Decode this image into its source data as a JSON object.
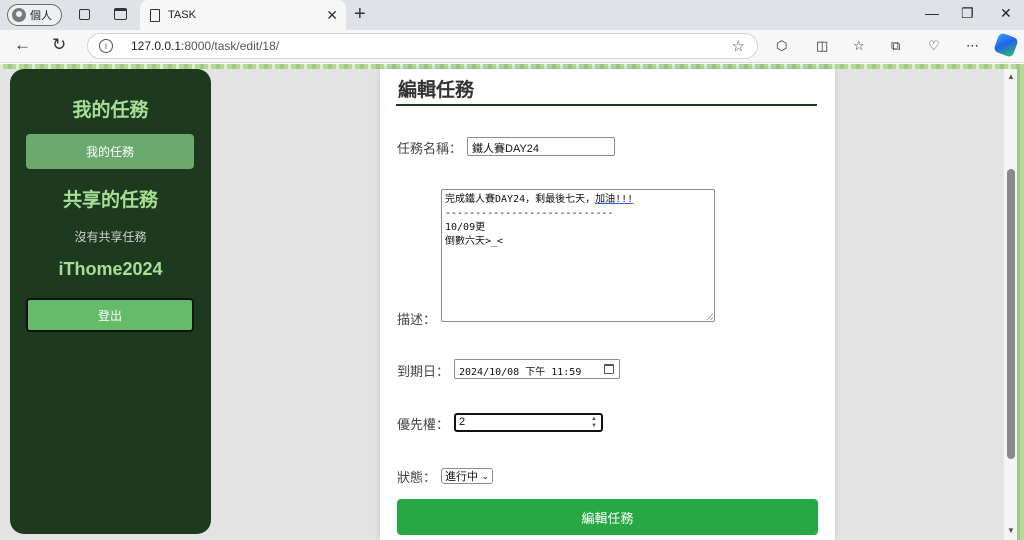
{
  "browser": {
    "profile_label": "個人",
    "tab_title": "TASK",
    "url_host": "127.0.0.1",
    "url_path": ":8000/task/edit/18/"
  },
  "sidebar": {
    "my_tasks_title": "我的任務",
    "my_tasks_button": "我的任務",
    "shared_title": "共享的任務",
    "shared_empty": "沒有共享任務",
    "username": "iThome2024",
    "logout_button": "登出"
  },
  "form": {
    "heading": "編輯任務",
    "name_label": "任務名稱：",
    "name_value": "鐵人賽DAY24",
    "desc_label": "描述：",
    "desc_line1_prefix": "完成鐵人賽DAY24，剩最後七天，",
    "desc_line1_underlined": "加油!!!",
    "desc_line2": "----------------------------",
    "desc_line3": "10/09更",
    "desc_line4": "倒數六天>_<",
    "due_label": "到期日：",
    "due_value": "2024/10/08 下午 11:59",
    "priority_label": "優先權：",
    "priority_value": "2",
    "status_label": "狀態：",
    "status_value": "進行中",
    "submit_button": "編輯任務"
  },
  "colors": {
    "sidebar_bg": "#1d3a1f",
    "sidebar_text": "#a6df96",
    "submit_bg": "#28a745",
    "logout_bg": "#66bb6a"
  }
}
